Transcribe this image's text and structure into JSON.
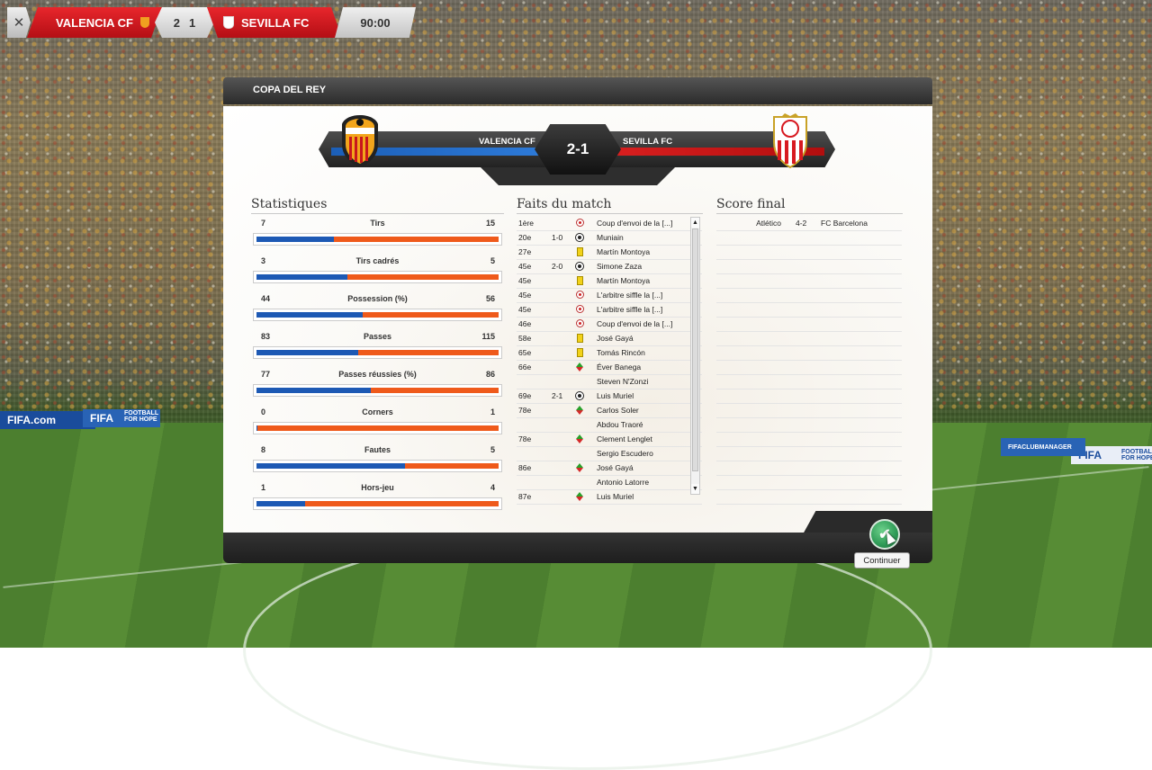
{
  "topbar": {
    "home_team": "VALENCIA CF",
    "home_goals": "2",
    "away_goals": "1",
    "away_team": "SEVILLA FC",
    "clock": "90:00",
    "settings_icon": "tools-icon"
  },
  "dialog": {
    "competition": "COPA DEL REY",
    "banner": {
      "home_team": "VALENCIA CF",
      "score": "2-1",
      "away_team": "SEVILLA FC"
    },
    "sections": {
      "stats": "Statistiques",
      "events": "Faits du match",
      "final_scores": "Score final"
    },
    "stats": [
      {
        "name": "Tirs",
        "home": "7",
        "away": "15",
        "home_share": 0.318
      },
      {
        "name": "Tirs cadrés",
        "home": "3",
        "away": "5",
        "home_share": 0.375
      },
      {
        "name": "Possession (%)",
        "home": "44",
        "away": "56",
        "home_share": 0.44
      },
      {
        "name": "Passes",
        "home": "83",
        "away": "115",
        "home_share": 0.419
      },
      {
        "name": "Passes réussies (%)",
        "home": "77",
        "away": "86",
        "home_share": 0.472
      },
      {
        "name": "Corners",
        "home": "0",
        "away": "1",
        "home_share": 0.0
      },
      {
        "name": "Fautes",
        "home": "8",
        "away": "5",
        "home_share": 0.615
      },
      {
        "name": "Hors-jeu",
        "home": "1",
        "away": "4",
        "home_share": 0.2
      }
    ],
    "events": [
      {
        "minute": "1ère",
        "score": "",
        "icon": "whistle",
        "text": "Coup d'envoi de la [...]"
      },
      {
        "minute": "20e",
        "score": "1-0",
        "icon": "ball",
        "text": "Muniain"
      },
      {
        "minute": "27e",
        "score": "",
        "icon": "yellow-card",
        "text": "Martín Montoya"
      },
      {
        "minute": "45e",
        "score": "2-0",
        "icon": "ball",
        "text": "Simone Zaza"
      },
      {
        "minute": "45e",
        "score": "",
        "icon": "yellow-card",
        "text": "Martín Montoya"
      },
      {
        "minute": "45e",
        "score": "",
        "icon": "whistle",
        "text": "L'arbitre siffle la [...]"
      },
      {
        "minute": "45e",
        "score": "",
        "icon": "whistle",
        "text": "L'arbitre siffle la [...]"
      },
      {
        "minute": "46e",
        "score": "",
        "icon": "whistle",
        "text": "Coup d'envoi de la [...]"
      },
      {
        "minute": "58e",
        "score": "",
        "icon": "yellow-card",
        "text": "José Gayá"
      },
      {
        "minute": "65e",
        "score": "",
        "icon": "yellow-card",
        "text": "Tomás Rincón"
      },
      {
        "minute": "66e",
        "score": "",
        "icon": "substitution",
        "text": "Éver Banega"
      },
      {
        "minute": "",
        "score": "",
        "icon": "",
        "text": "Steven N'Zonzi"
      },
      {
        "minute": "69e",
        "score": "2-1",
        "icon": "ball",
        "text": "Luis Muriel"
      },
      {
        "minute": "78e",
        "score": "",
        "icon": "substitution",
        "text": "Carlos Soler"
      },
      {
        "minute": "",
        "score": "",
        "icon": "",
        "text": "Abdou Traoré"
      },
      {
        "minute": "78e",
        "score": "",
        "icon": "substitution",
        "text": "Clement Lenglet"
      },
      {
        "minute": "",
        "score": "",
        "icon": "",
        "text": "Sergio Escudero"
      },
      {
        "minute": "86e",
        "score": "",
        "icon": "substitution",
        "text": "José Gayá"
      },
      {
        "minute": "",
        "score": "",
        "icon": "",
        "text": "Antonio Latorre"
      },
      {
        "minute": "87e",
        "score": "",
        "icon": "substitution",
        "text": "Luis Muriel"
      }
    ],
    "final_scores": [
      {
        "home": "Atlético",
        "score": "4-2",
        "away": "FC Barcelona"
      },
      {
        "home": "",
        "score": "",
        "away": ""
      },
      {
        "home": "",
        "score": "",
        "away": ""
      },
      {
        "home": "",
        "score": "",
        "away": ""
      },
      {
        "home": "",
        "score": "",
        "away": ""
      },
      {
        "home": "",
        "score": "",
        "away": ""
      },
      {
        "home": "",
        "score": "",
        "away": ""
      },
      {
        "home": "",
        "score": "",
        "away": ""
      },
      {
        "home": "",
        "score": "",
        "away": ""
      },
      {
        "home": "",
        "score": "",
        "away": ""
      },
      {
        "home": "",
        "score": "",
        "away": ""
      },
      {
        "home": "",
        "score": "",
        "away": ""
      },
      {
        "home": "",
        "score": "",
        "away": ""
      },
      {
        "home": "",
        "score": "",
        "away": ""
      },
      {
        "home": "",
        "score": "",
        "away": ""
      },
      {
        "home": "",
        "score": "",
        "away": ""
      },
      {
        "home": "",
        "score": "",
        "away": ""
      },
      {
        "home": "",
        "score": "",
        "away": ""
      },
      {
        "home": "",
        "score": "",
        "away": ""
      },
      {
        "home": "",
        "score": "",
        "away": ""
      }
    ],
    "continue_label": "Continuer"
  },
  "adboards": {
    "left_1": "FIFA.com",
    "left_2": "FIFA",
    "left_3": "FOOTBALL FOR HOPE",
    "right_1": "FIFA",
    "right_2": "FOOTBALL FOR HOPE",
    "right_3": "FIFACLUBMANAGER"
  },
  "colors": {
    "home_accent": "#1d59b4",
    "away_accent": "#ef5a1b",
    "topbar_red": "#d61a20",
    "continue_green": "#2e9a56"
  }
}
